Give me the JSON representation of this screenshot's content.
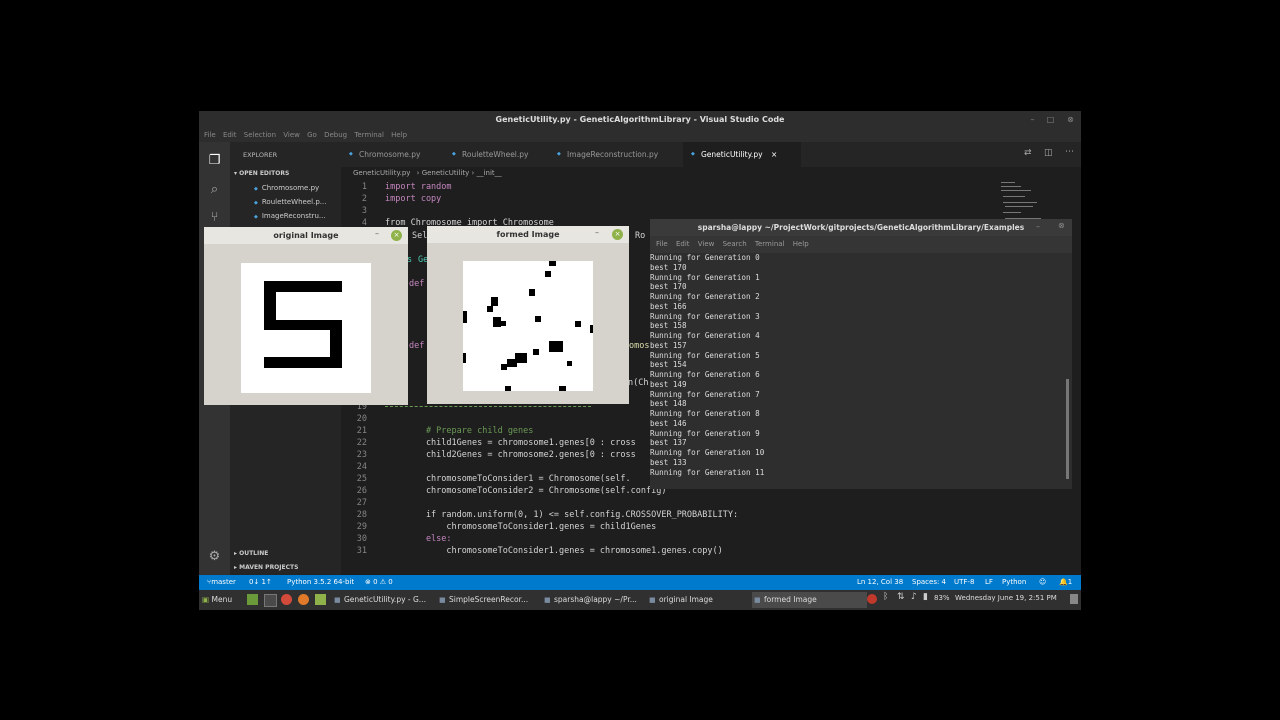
{
  "vscode": {
    "title": "GeneticUtility.py - GeneticAlgorithmLibrary - Visual Studio Code",
    "menu": [
      "File",
      "Edit",
      "Selection",
      "View",
      "Go",
      "Debug",
      "Terminal",
      "Help"
    ],
    "sidebar": {
      "header": "EXPLORER",
      "open_editors": "OPEN EDITORS",
      "files": [
        "Chromosome.py",
        "RouletteWheel.p...",
        "ImageReconstru..."
      ],
      "outline": "OUTLINE",
      "maven": "MAVEN PROJECTS"
    },
    "tabs": [
      "Chromosome.py",
      "RouletteWheel.py",
      "ImageReconstruction.py",
      "GeneticUtility.py"
    ],
    "active_tab_close": "×",
    "breadcrumb": {
      "file": "GeneticUtility.py",
      "cls": "GeneticUtility",
      "method": "__init__"
    },
    "lines_top": [
      {
        "n": "1",
        "text": "import random"
      },
      {
        "n": "2",
        "text": "import copy"
      },
      {
        "n": "3",
        "text": ""
      },
      {
        "n": "4",
        "text": "from Chromosome import Chromosome"
      }
    ],
    "partial": {
      "sel": "Sel",
      "s": "s",
      "ge": "Ge",
      "def1": "def",
      "def2": "def",
      "omos": "omos",
      "ro": "Ro",
      "nc": "n(Ch"
    },
    "recomb": "Recombinati",
    "lines_bottom": [
      {
        "n": "19",
        "text": ""
      },
      {
        "n": "20",
        "text": ""
      },
      {
        "n": "21",
        "text": "        # Prepare child genes"
      },
      {
        "n": "22",
        "text": "        child1Genes = chromosome1.genes[0 : cross"
      },
      {
        "n": "23",
        "text": "        child2Genes = chromosome2.genes[0 : cross"
      },
      {
        "n": "24",
        "text": ""
      },
      {
        "n": "25",
        "text": "        chromosomeToConsider1 = Chromosome(self."
      },
      {
        "n": "26",
        "text": "        chromosomeToConsider2 = Chromosome(self.config)"
      },
      {
        "n": "27",
        "text": ""
      },
      {
        "n": "28",
        "text": "        if random.uniform(0, 1) <= self.config.CROSSOVER_PROBABILITY:"
      },
      {
        "n": "29",
        "text": "            chromosomeToConsider1.genes = child1Genes"
      },
      {
        "n": "30",
        "text": "        else:"
      },
      {
        "n": "31",
        "text": "            chromosomeToConsider1.genes = chromosome1.genes.copy()"
      }
    ],
    "status": {
      "branch": "master",
      "sync": "0↓ 1↑",
      "python": "Python 3.5.2 64-bit",
      "problems": "⊗ 0 ⚠ 0",
      "position": "Ln 12, Col 38",
      "spaces": "Spaces: 4",
      "encoding": "UTF-8",
      "eol": "LF",
      "lang": "Python",
      "bell": "1"
    }
  },
  "original_window": {
    "title": "original Image"
  },
  "formed_window": {
    "title": "formed Image"
  },
  "terminal": {
    "title": "sparsha@lappy ~/ProjectWork/gitprojects/GeneticAlgorithmLibrary/Examples",
    "menu": [
      "File",
      "Edit",
      "View",
      "Search",
      "Terminal",
      "Help"
    ],
    "lines": [
      "Running for Generation 0",
      "best 170",
      "Running for Generation 1",
      "best 170",
      "Running for Generation 2",
      "best 166",
      "Running for Generation 3",
      "best 158",
      "Running for Generation 4",
      "best 157",
      "Running for Generation 5",
      "best 154",
      "Running for Generation 6",
      "best 149",
      "Running for Generation 7",
      "best 148",
      "Running for Generation 8",
      "best 146",
      "Running for Generation 9",
      "best 137",
      "Running for Generation 10",
      "best 133",
      "Running for Generation 11"
    ]
  },
  "taskbar": {
    "menu": "Menu",
    "tasks": [
      "GeneticUtility.py - G...",
      "SimpleScreenRecor...",
      "sparsha@lappy ~/Pr...",
      "original Image",
      "formed Image"
    ],
    "battery": "83%",
    "datetime": "Wednesday June 19,  2:51 PM"
  }
}
